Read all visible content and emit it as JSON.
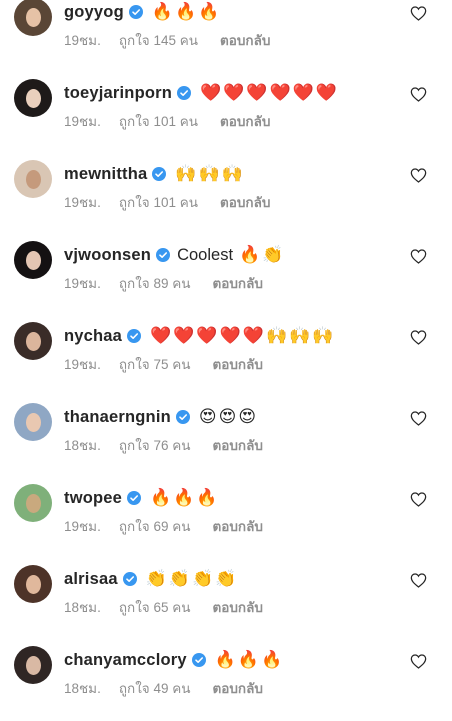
{
  "ui": {
    "accent": "#3897f0",
    "text": "#262626",
    "muted": "#8e8e8e"
  },
  "comments": [
    {
      "username": "goyyog",
      "verified": true,
      "text": "",
      "emojis": [
        "🔥",
        "🔥",
        "🔥"
      ],
      "emoji_kind": "fire",
      "time": "19ชม.",
      "likes": "ถูกใจ 145 คน",
      "reply": "ตอบกลับ",
      "avatar": {
        "hair": "#5a4636",
        "skin": "#e6c2a6"
      }
    },
    {
      "username": "toeyjarinporn",
      "verified": true,
      "text": "",
      "emojis": [
        "❤️",
        "❤️",
        "❤️",
        "❤️",
        "❤️",
        "❤️"
      ],
      "emoji_kind": "heart",
      "time": "19ชม.",
      "likes": "ถูกใจ 101 คน",
      "reply": "ตอบกลับ",
      "avatar": {
        "hair": "#1e1a19",
        "skin": "#ead0bd"
      }
    },
    {
      "username": "mewnittha",
      "verified": true,
      "text": "",
      "emojis": [
        "🙌",
        "🙌",
        "🙌"
      ],
      "emoji_kind": "raised",
      "time": "19ชม.",
      "likes": "ถูกใจ 101 คน",
      "reply": "ตอบกลับ",
      "avatar": {
        "hair": "#d9c6b4",
        "skin": "#c59a7c"
      }
    },
    {
      "username": "vjwoonsen",
      "verified": true,
      "text": "Coolest",
      "emojis": [
        "🔥",
        "👏"
      ],
      "emoji_kind": "mixed",
      "time": "19ชม.",
      "likes": "ถูกใจ 89 คน",
      "reply": "ตอบกลับ",
      "avatar": {
        "hair": "#141112",
        "skin": "#e4c6b3"
      }
    },
    {
      "username": "nychaa",
      "verified": true,
      "text": "",
      "emojis": [
        "❤️",
        "❤️",
        "❤️",
        "❤️",
        "❤️",
        "🙌",
        "🙌",
        "🙌"
      ],
      "emoji_kind": "mixed",
      "time": "19ชม.",
      "likes": "ถูกใจ 75 คน",
      "reply": "ตอบกลับ",
      "avatar": {
        "hair": "#3a2c28",
        "skin": "#dbb59c"
      }
    },
    {
      "username": "thanaerngnin",
      "verified": true,
      "text": "",
      "emojis": [
        "😍",
        "😍",
        "😍"
      ],
      "emoji_kind": "hearteyes",
      "time": "18ชม.",
      "likes": "ถูกใจ 76 คน",
      "reply": "ตอบกลับ",
      "avatar": {
        "hair": "#8fa7c4",
        "skin": "#e9c8b1"
      }
    },
    {
      "username": "twopee",
      "verified": true,
      "text": "",
      "emojis": [
        "🔥",
        "🔥",
        "🔥"
      ],
      "emoji_kind": "fire",
      "time": "19ชม.",
      "likes": "ถูกใจ 69 คน",
      "reply": "ตอบกลับ",
      "avatar": {
        "hair": "#7fb07a",
        "skin": "#c9a97e"
      }
    },
    {
      "username": "alrisaa",
      "verified": true,
      "text": "",
      "emojis": [
        "👏",
        "👏",
        "👏",
        "👏"
      ],
      "emoji_kind": "clap",
      "time": "18ชม.",
      "likes": "ถูกใจ 65 คน",
      "reply": "ตอบกลับ",
      "avatar": {
        "hair": "#4d3328",
        "skin": "#e0b89c"
      }
    },
    {
      "username": "chanyamcclory",
      "verified": true,
      "text": "",
      "emojis": [
        "🔥",
        "🔥",
        "🔥"
      ],
      "emoji_kind": "fire",
      "time": "18ชม.",
      "likes": "ถูกใจ 49 คน",
      "reply": "ตอบกลับ",
      "avatar": {
        "hair": "#2f2624",
        "skin": "#d9b9a4"
      }
    }
  ]
}
